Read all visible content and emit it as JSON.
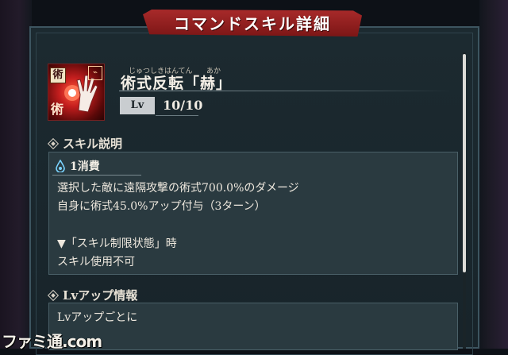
{
  "header": {
    "title": "コマンドスキル詳細"
  },
  "skill": {
    "icon": "technique-hand-icon",
    "icon_tag": "術",
    "icon_tag_bottom": "術",
    "name": "術式反転「赫」",
    "furigana_main": "じゅつしきはんてん",
    "furigana_sub": "あか",
    "level_label": "Lv",
    "level_value": "10/10"
  },
  "description": {
    "section_title": "スキル説明",
    "cost_icon": "water-drop-icon",
    "cost": "1消費",
    "lines": [
      "選択した敵に遠隔攻撃の術式700.0%のダメージ",
      "自身に術式45.0%アップ付与（3ターン）",
      "▼「スキル制限状態」時",
      "スキル使用不可"
    ]
  },
  "level_up": {
    "section_title": "Lvアップ情報",
    "first_line": "Lvアップごとに"
  },
  "watermark": "ファミ通.com",
  "colors": {
    "banner": "#a82a2a",
    "panel": "#1c2a30",
    "box": "#2a3a40",
    "accent_border": "#4a6068"
  }
}
